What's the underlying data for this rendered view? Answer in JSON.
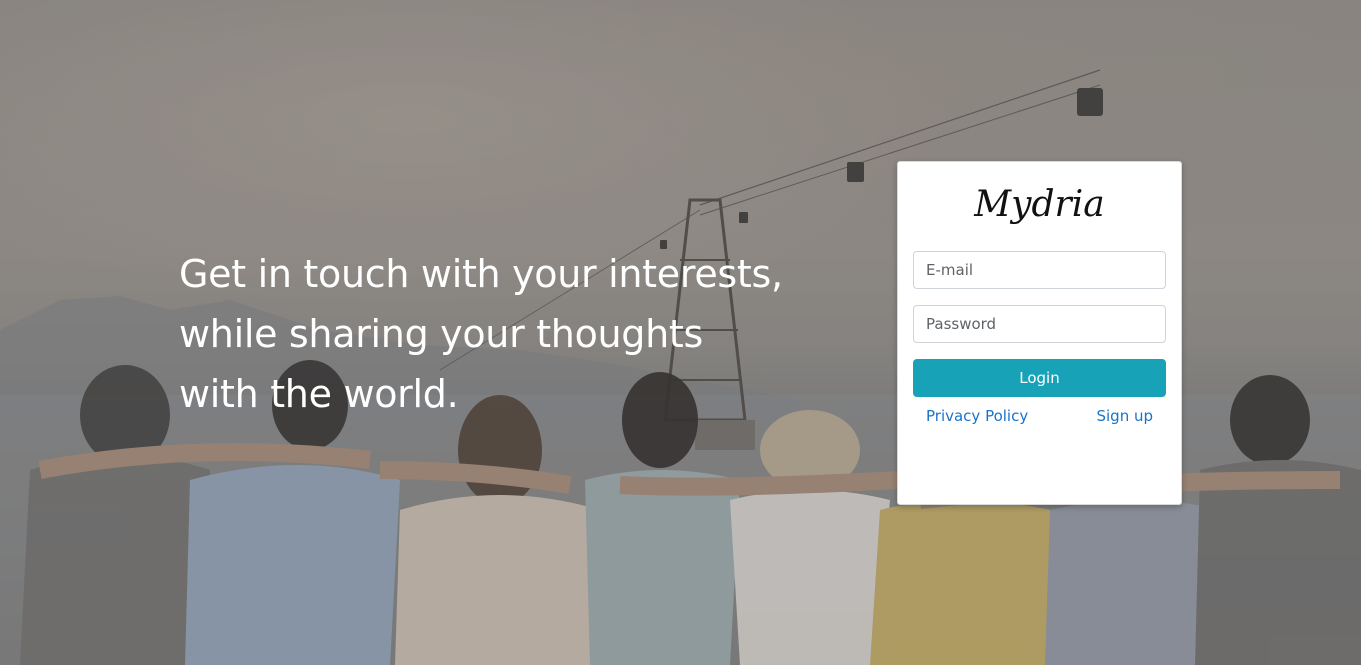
{
  "hero": {
    "headline": "Get in touch with your interests, while sharing your thoughts with the world."
  },
  "login_card": {
    "brand": "Mydria",
    "email_placeholder": "E-mail",
    "password_placeholder": "Password",
    "login_label": "Login",
    "privacy_label": "Privacy Policy",
    "signup_label": "Sign up"
  },
  "colors": {
    "login_button": "#17a2b8",
    "link": "#1a73c9"
  }
}
